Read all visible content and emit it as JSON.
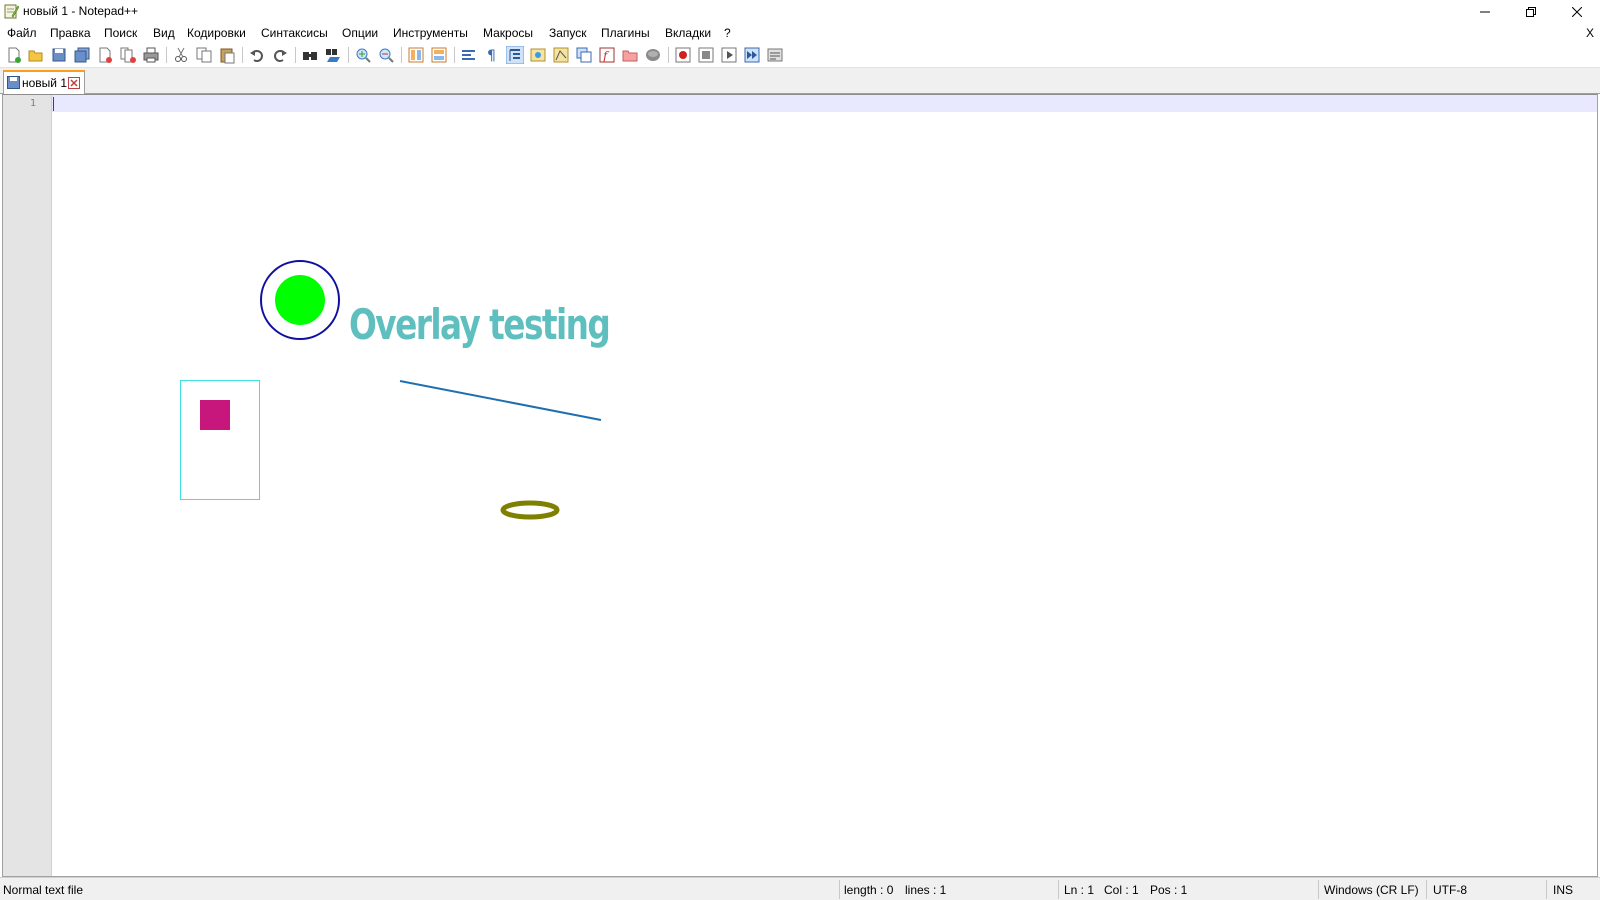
{
  "window": {
    "title": "новый 1 - Notepad++",
    "minimize_glyph": "minimize-icon",
    "restore_glyph": "restore-icon",
    "close_glyph": "close-icon"
  },
  "menu": {
    "items": [
      {
        "label": "Файл"
      },
      {
        "label": "Правка"
      },
      {
        "label": "Поиск"
      },
      {
        "label": "Вид"
      },
      {
        "label": "Кодировки"
      },
      {
        "label": "Синтаксисы"
      },
      {
        "label": "Опции"
      },
      {
        "label": "Инструменты"
      },
      {
        "label": "Макросы"
      },
      {
        "label": "Запуск"
      },
      {
        "label": "Плагины"
      },
      {
        "label": "Вкладки"
      },
      {
        "label": "?"
      }
    ],
    "close_doc": "X"
  },
  "toolbar": {
    "icons": [
      "new-file-icon",
      "open-file-icon",
      "save-icon",
      "save-all-icon",
      "close-icon",
      "close-all-icon",
      "print-icon",
      "cut-icon",
      "copy-icon",
      "paste-icon",
      "undo-icon",
      "redo-icon",
      "find-icon",
      "replace-icon",
      "zoom-in-icon",
      "zoom-out-icon",
      "sync-vertical-icon",
      "sync-horizontal-icon",
      "word-wrap-icon",
      "show-all-chars-icon",
      "indent-guide-icon",
      "user-language-icon",
      "doc-map-icon",
      "doc-list-icon",
      "function-list-icon",
      "folder-workspace-icon",
      "monitoring-icon",
      "record-macro-icon",
      "stop-record-icon",
      "play-macro-icon",
      "run-macro-multiple-icon",
      "save-macro-icon"
    ]
  },
  "tabs": [
    {
      "label": "новый 1",
      "active": true
    }
  ],
  "editor": {
    "line_numbers": [
      "1"
    ],
    "content": ""
  },
  "overlay": {
    "text": "Overlay testing",
    "text_color": "#5fbfbf",
    "circle_outer_color": "#1010a0",
    "circle_inner_color": "#00ff00",
    "rect_outline_color": "#40e0e0",
    "rect_fill_color": "#c8177c",
    "line_color": "#1f6fb0",
    "ellipse_color": "#808000"
  },
  "status": {
    "file_type": "Normal text file",
    "length": "length : 0",
    "lines": "lines : 1",
    "ln": "Ln : 1",
    "col": "Col : 1",
    "pos": "Pos : 1",
    "eol": "Windows (CR LF)",
    "encoding": "UTF-8",
    "mode": "INS"
  }
}
